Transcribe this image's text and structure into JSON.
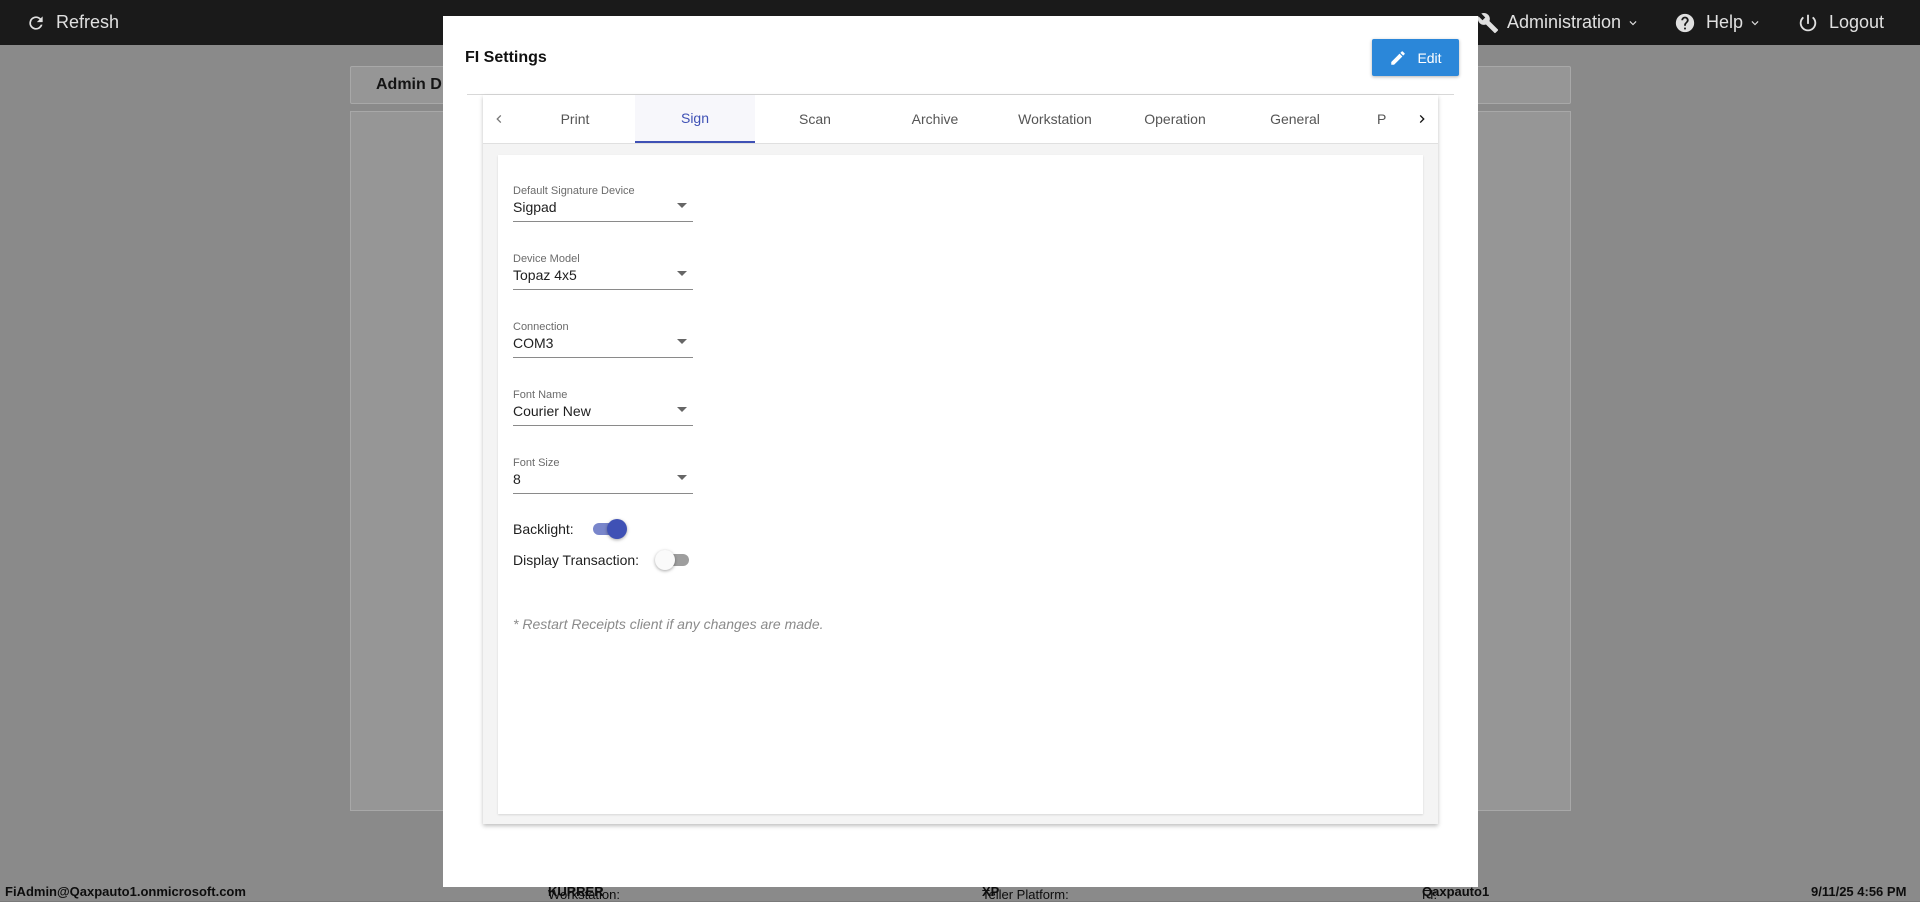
{
  "topbar": {
    "refresh_label": "Refresh",
    "administration_label": "Administration",
    "help_label": "Help",
    "logout_label": "Logout"
  },
  "background": {
    "panel_title": "Admin D"
  },
  "modal": {
    "title": "FI Settings",
    "edit_label": "Edit",
    "tabs": [
      "Print",
      "Sign",
      "Scan",
      "Archive",
      "Workstation",
      "Operation",
      "General",
      "P"
    ],
    "active_tab": "Sign",
    "fields": [
      {
        "label": "Default Signature Device",
        "value": "Sigpad"
      },
      {
        "label": "Device Model",
        "value": "Topaz 4x5"
      },
      {
        "label": "Connection",
        "value": "COM3"
      },
      {
        "label": "Font Name",
        "value": "Courier New"
      },
      {
        "label": "Font Size",
        "value": "8"
      }
    ],
    "toggles": [
      {
        "label": "Backlight:",
        "on": true
      },
      {
        "label": "Display Transaction:",
        "on": false
      }
    ],
    "note": "* Restart Receipts client if any changes are made."
  },
  "statusbar": {
    "user": "FiAdmin@Qaxpauto1.onmicrosoft.com",
    "workstation_label": "Workstation:",
    "workstation_value": "KURRER",
    "platform_label": "Teller Platform:",
    "platform_value": "XP",
    "fi_label": "FI:",
    "fi_value": "Qaxpauto1",
    "datetime": "9/11/25 4:56 PM"
  },
  "colors": {
    "accent": "#3f51b5",
    "edit_button": "#2b87d9",
    "topbar": "#1a1a1a",
    "toggle_on_track": "#7986cb",
    "toggle_off_track": "#9e9e9e"
  }
}
